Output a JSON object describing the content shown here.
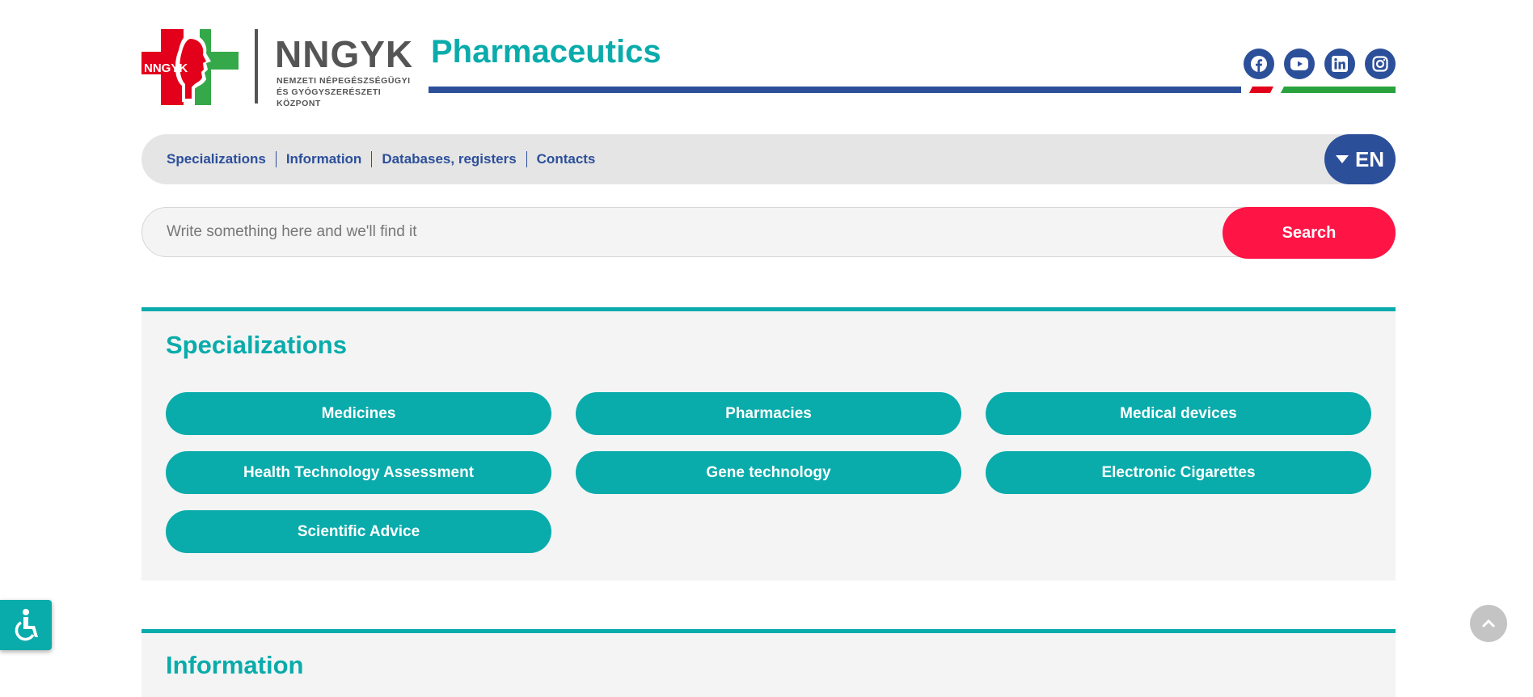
{
  "header": {
    "logo_badge": "NNGYK",
    "brand_name": "NNGYK",
    "brand_subtitle_line1": "NEMZETI NÉPEGÉSZSÉGÜGYI",
    "brand_subtitle_line2": "ÉS GYÓGYSZERÉSZETI KÖZPONT",
    "site_title": "Pharmaceutics",
    "social_icons": [
      "facebook-icon",
      "youtube-icon",
      "linkedin-icon",
      "instagram-icon"
    ]
  },
  "nav": {
    "items": [
      {
        "label": "Specializations"
      },
      {
        "label": "Information"
      },
      {
        "label": "Databases, registers"
      },
      {
        "label": "Contacts"
      }
    ],
    "language": "EN"
  },
  "search": {
    "placeholder": "Write something here and we'll find it",
    "value": "",
    "button_label": "Search"
  },
  "specializations": {
    "title": "Specializations",
    "buttons": [
      {
        "label": "Medicines"
      },
      {
        "label": "Pharmacies"
      },
      {
        "label": "Medical devices"
      },
      {
        "label": "Health Technology Assessment"
      },
      {
        "label": "Gene technology"
      },
      {
        "label": "Electronic Cigarettes"
      },
      {
        "label": "Scientific Advice"
      }
    ]
  },
  "information": {
    "title": "Information"
  },
  "colors": {
    "teal": "#0aabab",
    "navy": "#2c4f9a",
    "search_red": "#ff1446",
    "logo_red": "#e2001a",
    "logo_green": "#2aa33f"
  }
}
